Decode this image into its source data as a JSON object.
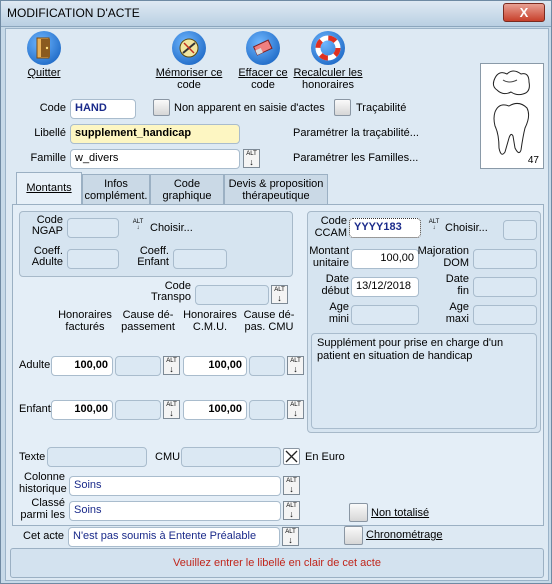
{
  "window": {
    "title": "MODIFICATION D'ACTE",
    "close_label": "X"
  },
  "toolbar": {
    "quit": "Quitter",
    "memorize_l1": "Mémoriser ce",
    "memorize_l2": "code",
    "erase_l1": "Effacer ce",
    "erase_l2": "code",
    "recalc_l1": "Recalculer les",
    "recalc_l2": "honoraires"
  },
  "header": {
    "code_label": "Code",
    "code_value": "HAND",
    "non_apparent_label": "Non apparent en saisie d'actes",
    "tracabilite_label": "Traçabilité",
    "libelle_label": "Libellé",
    "libelle_value": "supplement_handicap",
    "param_trace_label": "Paramétrer la traçabilité...",
    "famille_label": "Famille",
    "famille_value": "w_divers",
    "param_familles_label": "Paramétrer les Familles...",
    "tooth_number": "47",
    "alt_label": "ALT"
  },
  "tabs": [
    {
      "l1": "Montants",
      "l2": ""
    },
    {
      "l1": "Infos",
      "l2": "complément."
    },
    {
      "l1": "Code",
      "l2": "graphique"
    },
    {
      "l1": "Devis & proposition",
      "l2": "thérapeutique"
    }
  ],
  "montants": {
    "code_ngap_l1": "Code",
    "code_ngap_l2": "NGAP",
    "choisir": "Choisir...",
    "coeff_adulte_l1": "Coeff.",
    "coeff_adulte_l2": "Adulte",
    "coeff_enfant_l1": "Coeff.",
    "coeff_enfant_l2": "Enfant",
    "code_transpo_l1": "Code",
    "code_transpo_l2": "Transpo",
    "col_hf_l1": "Honoraires",
    "col_hf_l2": "facturés",
    "col_cd_l1": "Cause dé-",
    "col_cd_l2": "passement",
    "col_hcmu_l1": "Honoraires",
    "col_hcmu_l2": "C.M.U.",
    "col_cdcmu_l1": "Cause dé-",
    "col_cdcmu_l2": "pas. CMU",
    "adulte_label": "Adulte",
    "enfant_label": "Enfant",
    "adulte_hf": "100,00",
    "adulte_hcmu": "100,00",
    "enfant_hf": "100,00",
    "enfant_hcmu": "100,00",
    "texte_label": "Texte",
    "cmu_label": "CMU",
    "en_euro_label": "En Euro",
    "colonne_l1": "Colonne",
    "colonne_l2": "historique",
    "colonne_value": "Soins",
    "classe_l1": "Classé",
    "classe_l2": "parmi les",
    "classe_value": "Soins",
    "cet_acte_label": "Cet acte",
    "cet_acte_value": "N'est pas soumis à Entente Préalable",
    "non_totalise_label": "Non totalisé",
    "chrono_label": "Chronométrage"
  },
  "ccam": {
    "code_l1": "Code",
    "code_l2": "CCAM",
    "code_value": "YYYY183",
    "choisir": "Choisir...",
    "montant_l1": "Montant",
    "montant_l2": "unitaire",
    "montant_value": "100,00",
    "majoration_l1": "Majoration",
    "majoration_l2": "DOM",
    "date_debut_l1": "Date",
    "date_debut_l2": "début",
    "date_debut_value": "13/12/2018",
    "date_fin_l1": "Date",
    "date_fin_l2": "fin",
    "age_mini_l1": "Age",
    "age_mini_l2": "mini",
    "age_maxi_l1": "Age",
    "age_maxi_l2": "maxi",
    "description": "Supplément pour prise en charge d'un patient en situation de handicap"
  },
  "status": {
    "part1": "Veuillez entrer le ",
    "part2": "libellé",
    "part3": " en clair de cet acte"
  },
  "colors": {
    "accent_red": "#c0251b",
    "field_text": "#1a2a8a"
  }
}
